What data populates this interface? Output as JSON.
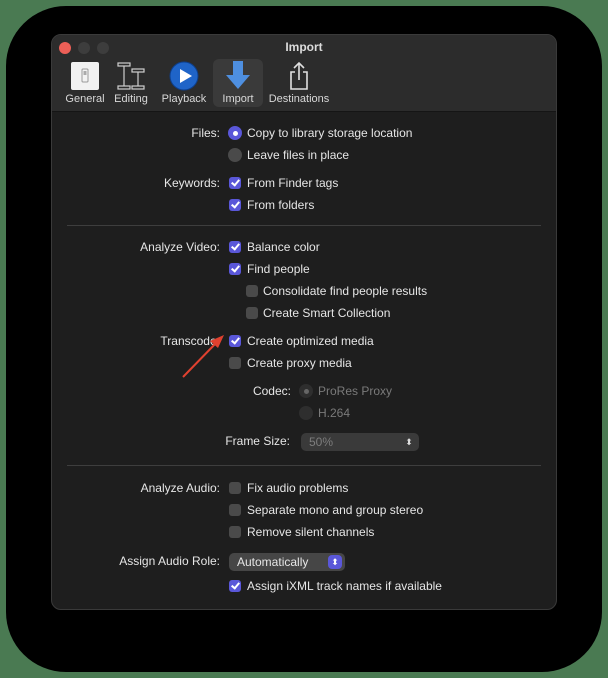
{
  "window": {
    "title": "Import",
    "toolbar": [
      {
        "label": "General",
        "icon": "general-switch-icon"
      },
      {
        "label": "Editing",
        "icon": "film-editing-icon"
      },
      {
        "label": "Playback",
        "icon": "play-icon"
      },
      {
        "label": "Import",
        "icon": "import-arrow-icon",
        "selected": true
      },
      {
        "label": "Destinations",
        "icon": "share-icon"
      }
    ]
  },
  "files": {
    "label": "Files:",
    "options": [
      {
        "label": "Copy to library storage location",
        "selected": true
      },
      {
        "label": "Leave files in place",
        "selected": false
      }
    ]
  },
  "keywords": {
    "label": "Keywords:",
    "items": [
      {
        "label": "From Finder tags",
        "checked": true
      },
      {
        "label": "From folders",
        "checked": true
      }
    ]
  },
  "analyze_video": {
    "label": "Analyze Video:",
    "items": [
      {
        "label": "Balance color",
        "checked": true
      },
      {
        "label": "Find people",
        "checked": true
      },
      {
        "label": "Consolidate find people results",
        "checked": false
      },
      {
        "label": "Create Smart Collection",
        "checked": false
      }
    ]
  },
  "transcode": {
    "label": "Transcode:",
    "items": [
      {
        "label": "Create optimized media",
        "checked": true
      },
      {
        "label": "Create proxy media",
        "checked": false
      }
    ],
    "codec_label": "Codec:",
    "codec_options": [
      {
        "label": "ProRes Proxy",
        "selected": true
      },
      {
        "label": "H.264",
        "selected": false
      }
    ],
    "frame_size_label": "Frame Size:",
    "frame_size_value": "50%"
  },
  "analyze_audio": {
    "label": "Analyze Audio:",
    "items": [
      {
        "label": "Fix audio problems",
        "checked": false
      },
      {
        "label": "Separate mono and group stereo",
        "checked": false
      },
      {
        "label": "Remove silent channels",
        "checked": false
      }
    ]
  },
  "audio_role": {
    "label": "Assign Audio Role:",
    "value": "Automatically",
    "ixml": {
      "label": "Assign iXML track names if available",
      "checked": true
    }
  },
  "annotation": {
    "arrow_color": "#e0412f"
  },
  "colors": {
    "accent": "#5a57d9",
    "close": "#ec5f57"
  }
}
